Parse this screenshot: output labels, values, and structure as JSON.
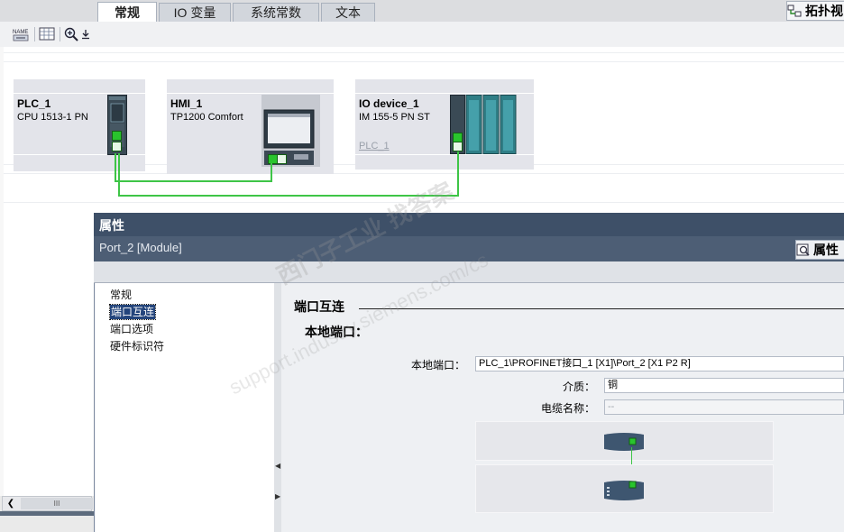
{
  "top_tab": {
    "label": "拓扑视"
  },
  "toolbar": {
    "name_icon_text": "NAME"
  },
  "devices": [
    {
      "name": "PLC_1",
      "type": "CPU 1513-1 PN",
      "sub": ""
    },
    {
      "name": "HMI_1",
      "type": "TP1200 Comfort",
      "sub": ""
    },
    {
      "name": "IO device_1",
      "type": "IM 155-5 PN ST",
      "sub": "PLC_1"
    }
  ],
  "properties": {
    "title": "属性",
    "module": "Port_2 [Module]",
    "right_tab": "属性",
    "tabs": [
      "常规",
      "IO 变量",
      "系统常数",
      "文本"
    ],
    "nav": [
      "常规",
      "端口互连",
      "端口选项",
      "硬件标识符"
    ],
    "section": "端口互连",
    "subsection": "本地端口：",
    "fields": {
      "local_port_label": "本地端口：",
      "local_port_value": "PLC_1\\PROFINET接口_1 [X1]\\Port_2 [X1 P2 R]",
      "medium_label": "介质：",
      "medium_value": "铜",
      "cable_label": "电缆名称：",
      "cable_value": "--"
    }
  },
  "watermark": {
    "line1": "西门子工业  找答案",
    "line2": "support.industry.siemens.com/cs"
  },
  "scroll": {
    "thumb": "III"
  },
  "colors": {
    "wire": "#3ec547",
    "port": "#29c42d",
    "title_bar": "#3e5068",
    "selected": "#24457c"
  }
}
